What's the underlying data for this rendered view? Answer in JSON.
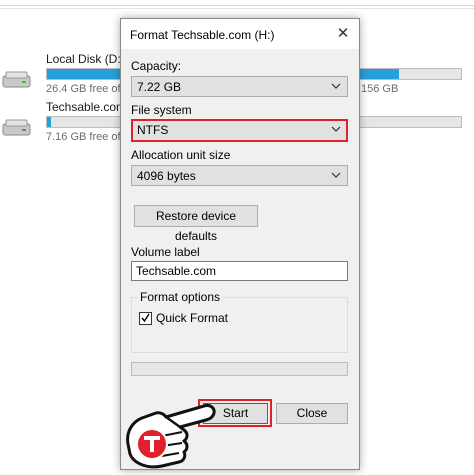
{
  "explorer": {
    "drives": [
      {
        "name": "Local Disk (D:)",
        "free_text": "26.4 GB free of",
        "free_right": "156 GB",
        "used_fraction": 0.85
      },
      {
        "name": "Techsable.com",
        "free_text": "7.16 GB free of",
        "free_right": "",
        "used_fraction": 0.01
      }
    ]
  },
  "dialog": {
    "title": "Format Techsable.com (H:)",
    "close_glyph": "✕",
    "capacity": {
      "label": "Capacity:",
      "value": "7.22 GB"
    },
    "file_system": {
      "label": "File system",
      "value": "NTFS"
    },
    "allocation": {
      "label": "Allocation unit size",
      "value": "4096 bytes"
    },
    "restore_button": "Restore device defaults",
    "volume": {
      "label": "Volume label",
      "value": "Techsable.com"
    },
    "options": {
      "legend": "Format options",
      "quick_format_label": "Quick Format",
      "quick_format_checked": true
    },
    "progress": 0,
    "start_button": "Start",
    "close_button": "Close"
  },
  "colors": {
    "accent": "#26a0da",
    "highlight_red": "#e0202a",
    "focus_blue": "#0078d7"
  },
  "icons": [
    "hard-drive-icon",
    "usb-drive-icon",
    "chevron-down-icon",
    "close-icon",
    "checkmark-icon",
    "pointing-hand-icon",
    "brand-logo-icon"
  ]
}
